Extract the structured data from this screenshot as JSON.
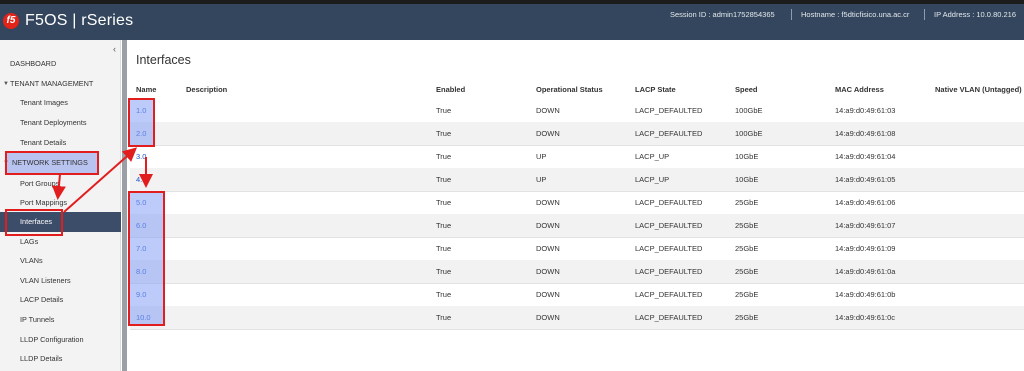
{
  "header": {
    "logo_text": "f5",
    "brand": "F5OS | rSeries",
    "session": "Session ID : admin1752854365",
    "hostname": "Hostname : f5dticfisico.una.ac.cr",
    "ip": "IP Address : 10.0.80.216",
    "bg_color": "#33465d"
  },
  "sidebar": {
    "collapse_glyph": "‹",
    "items": [
      {
        "label": "DASHBOARD"
      },
      {
        "label": "TENANT MANAGEMENT"
      },
      {
        "label": "Tenant Images"
      },
      {
        "label": "Tenant Deployments"
      },
      {
        "label": "Tenant Details"
      },
      {
        "label": "NETWORK SETTINGS"
      },
      {
        "label": "Port Groups"
      },
      {
        "label": "Port Mappings"
      },
      {
        "label": "Interfaces"
      },
      {
        "label": "LAGs"
      },
      {
        "label": "VLANs"
      },
      {
        "label": "VLAN Listeners"
      },
      {
        "label": "LACP Details"
      },
      {
        "label": "IP Tunnels"
      },
      {
        "label": "LLDP Configuration"
      },
      {
        "label": "LLDP Details"
      }
    ]
  },
  "main": {
    "title": "Interfaces",
    "columns": [
      "Name",
      "Description",
      "Enabled",
      "Operational Status",
      "LACP State",
      "Speed",
      "MAC Address",
      "Native VLAN (Untagged)"
    ],
    "rows": [
      {
        "name": "1.0",
        "description": "",
        "enabled": "True",
        "status": "DOWN",
        "lacp": "LACP_DEFAULTED",
        "speed": "100GbE",
        "mac": "14:a9:d0:49:61:03"
      },
      {
        "name": "2.0",
        "description": "",
        "enabled": "True",
        "status": "DOWN",
        "lacp": "LACP_DEFAULTED",
        "speed": "100GbE",
        "mac": "14:a9:d0:49:61:08"
      },
      {
        "name": "3.0",
        "description": "",
        "enabled": "True",
        "status": "UP",
        "lacp": "LACP_UP",
        "speed": "10GbE",
        "mac": "14:a9:d0:49:61:04"
      },
      {
        "name": "4.0",
        "description": "",
        "enabled": "True",
        "status": "UP",
        "lacp": "LACP_UP",
        "speed": "10GbE",
        "mac": "14:a9:d0:49:61:05"
      },
      {
        "name": "5.0",
        "description": "",
        "enabled": "True",
        "status": "DOWN",
        "lacp": "LACP_DEFAULTED",
        "speed": "25GbE",
        "mac": "14:a9:d0:49:61:06"
      },
      {
        "name": "6.0",
        "description": "",
        "enabled": "True",
        "status": "DOWN",
        "lacp": "LACP_DEFAULTED",
        "speed": "25GbE",
        "mac": "14:a9:d0:49:61:07"
      },
      {
        "name": "7.0",
        "description": "",
        "enabled": "True",
        "status": "DOWN",
        "lacp": "LACP_DEFAULTED",
        "speed": "25GbE",
        "mac": "14:a9:d0:49:61:09"
      },
      {
        "name": "8.0",
        "description": "",
        "enabled": "True",
        "status": "DOWN",
        "lacp": "LACP_DEFAULTED",
        "speed": "25GbE",
        "mac": "14:a9:d0:49:61:0a"
      },
      {
        "name": "9.0",
        "description": "",
        "enabled": "True",
        "status": "DOWN",
        "lacp": "LACP_DEFAULTED",
        "speed": "25GbE",
        "mac": "14:a9:d0:49:61:0b"
      },
      {
        "name": "10.0",
        "description": "",
        "enabled": "True",
        "status": "DOWN",
        "lacp": "LACP_DEFAULTED",
        "speed": "25GbE",
        "mac": "14:a9:d0:49:61:0c"
      }
    ]
  },
  "annotation_color": "#e11d1d"
}
